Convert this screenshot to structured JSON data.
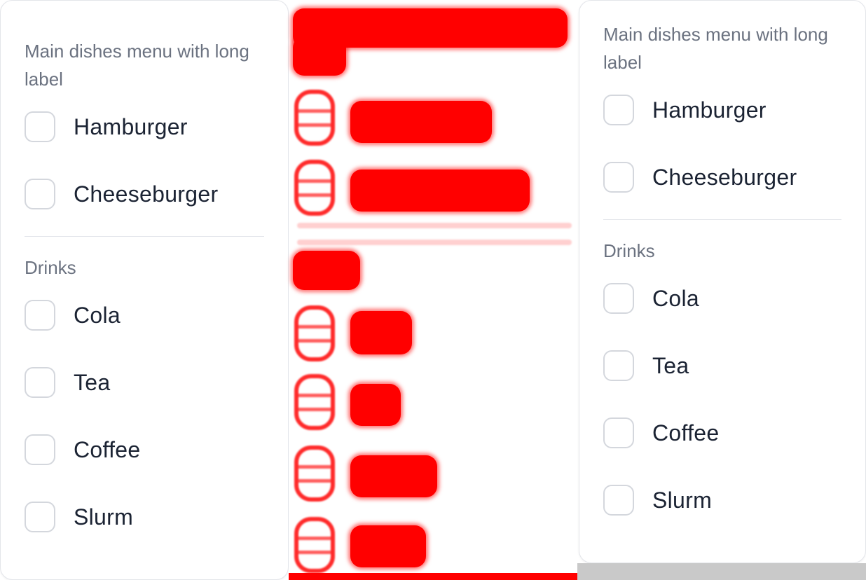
{
  "menus": [
    {
      "main_label": "Main dishes menu with long label",
      "main_items": [
        "Hamburger",
        "Cheeseburger"
      ],
      "drinks_label": "Drinks",
      "drink_items": [
        "Cola",
        "Tea",
        "Coffee",
        "Slurm"
      ]
    },
    {
      "main_label": "Main dishes menu with long label",
      "main_items": [
        "Hamburger",
        "Cheeseburger"
      ],
      "drinks_label": "Drinks",
      "drink_items": [
        "Cola",
        "Tea",
        "Coffee",
        "Slurm"
      ]
    }
  ],
  "colors": {
    "redaction": "#ff0000",
    "text": "#1b2333",
    "muted": "#6b7280",
    "border": "#d4d7dd"
  }
}
